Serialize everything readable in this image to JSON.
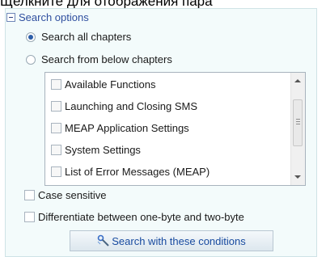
{
  "top_text": "Щелкните для отображения пара",
  "search_options": {
    "header_label": "Search options",
    "radio_options": [
      {
        "label": "Search all chapters",
        "checked": true
      },
      {
        "label": "Search from below chapters",
        "checked": false
      }
    ],
    "chapters": [
      "Available Functions",
      "Launching and Closing SMS",
      "MEAP Application Settings",
      "System Settings",
      "List of Error Messages (MEAP)"
    ],
    "checkboxes": [
      {
        "label": "Case sensitive",
        "checked": false
      },
      {
        "label": "Differentiate between one-byte and two-byte",
        "checked": false
      }
    ],
    "button_label": "Search with these conditions"
  },
  "colors": {
    "panel_bg": "#f3fbfb",
    "header_text": "#2f4f9f",
    "button_text": "#174a9f"
  },
  "icons": {
    "collapse": "minus-box-icon",
    "search": "search-icon"
  }
}
